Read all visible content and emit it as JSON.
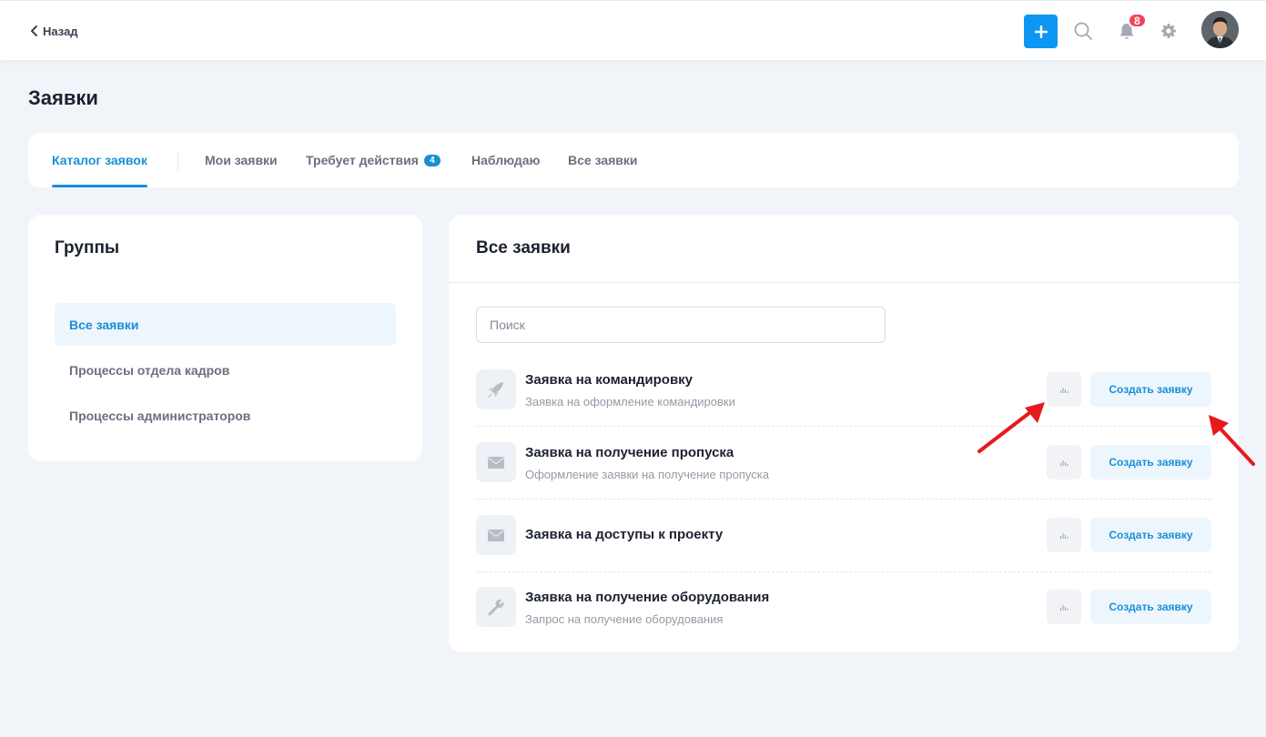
{
  "header": {
    "back_label": "Назад",
    "notification_count": "8"
  },
  "page": {
    "title": "Заявки"
  },
  "tabs": [
    {
      "label": "Каталог заявок",
      "active": true
    },
    {
      "label": "Мои заявки"
    },
    {
      "label": "Требует действия",
      "badge": "4"
    },
    {
      "label": "Наблюдаю"
    },
    {
      "label": "Все заявки"
    }
  ],
  "groups": {
    "title": "Группы",
    "items": [
      {
        "label": "Все заявки",
        "active": true
      },
      {
        "label": "Процессы отдела кадров"
      },
      {
        "label": "Процессы администраторов"
      }
    ]
  },
  "main": {
    "title": "Все заявки",
    "search_placeholder": "Поиск",
    "create_label": "Создать заявку",
    "requests": [
      {
        "title": "Заявка на командировку",
        "description": "Заявка на оформление командировки",
        "icon": "rocket-icon"
      },
      {
        "title": "Заявка на получение пропуска",
        "description": "Оформление заявки на получение пропуска",
        "icon": "envelope-icon"
      },
      {
        "title": "Заявка на доступы к проекту",
        "description": "",
        "icon": "envelope-icon"
      },
      {
        "title": "Заявка на получение оборудования",
        "description": "Запрос на получение оборудования",
        "icon": "wrench-icon"
      }
    ]
  },
  "colors": {
    "accent": "#1990d6",
    "primary_button": "#0d97f2",
    "badge": "#f0445c",
    "annotation_arrow": "#e8191c"
  }
}
